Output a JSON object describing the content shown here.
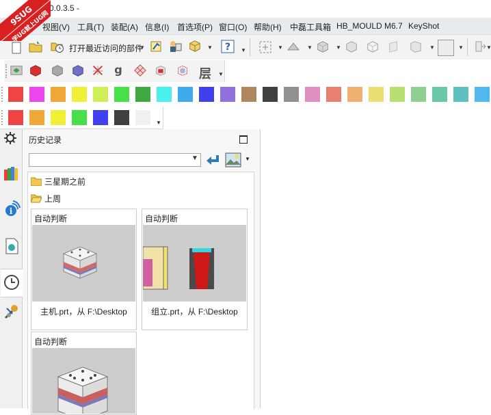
{
  "window": {
    "title": "0.0.3.5 -"
  },
  "logo": {
    "line1": "9SUG",
    "line2": "学UG就上UG网"
  },
  "menu": [
    {
      "label": "视图(V)"
    },
    {
      "label": "工具(T)"
    },
    {
      "label": "装配(A)"
    },
    {
      "label": "信息(I)"
    },
    {
      "label": "首选项(P)"
    },
    {
      "label": "窗口(O)"
    },
    {
      "label": "帮助(H)"
    },
    {
      "label": "中磊工具箱"
    },
    {
      "label": "HB_MOULD M6.7"
    },
    {
      "label": "KeyShot"
    }
  ],
  "toolbar": {
    "recent_parts_label": "打开最近访问的部件",
    "layer_label": "层"
  },
  "colors": {
    "palette_row1": [
      "#ee4444",
      "#ee44ee",
      "#f0a838",
      "#f0f038",
      "#d0ee58",
      "#48e048",
      "#40a840",
      "#48f0f0",
      "#40aaee",
      "#4040ee",
      "#9070dd",
      "#b08860",
      "#404040",
      "#909090",
      "#e090c0",
      "#e88070",
      "#f0b070",
      "#e8e070",
      "#b8e070",
      "#90d090",
      "#68c8a8",
      "#60c0c0",
      "#50b8ee"
    ],
    "palette_row2": [
      "#ee4444",
      "#f0a838",
      "#f0f038",
      "#48e048",
      "#4040ee",
      "#404040",
      "#f0f0f0"
    ],
    "menubar_bg": "#e8ebed",
    "thumb_bg": "#cdcdcd"
  },
  "sidebar": [
    {
      "icon": "gear-icon"
    },
    {
      "icon": "books-icon"
    },
    {
      "icon": "info-icon"
    },
    {
      "icon": "web-page-icon"
    },
    {
      "icon": "clock-icon"
    },
    {
      "icon": "tools-icon"
    }
  ],
  "history": {
    "title": "历史记录",
    "combo_value": "",
    "groups": [
      {
        "label": "三星期之前"
      },
      {
        "label": "上周"
      }
    ],
    "cards": [
      {
        "label": "自动判断",
        "caption": "主机.prt，从 F:\\Desktop"
      },
      {
        "label": "自动判断",
        "caption": "组立.prt，从 F:\\Desktop"
      },
      {
        "label": "自动判断",
        "caption": ""
      }
    ]
  }
}
